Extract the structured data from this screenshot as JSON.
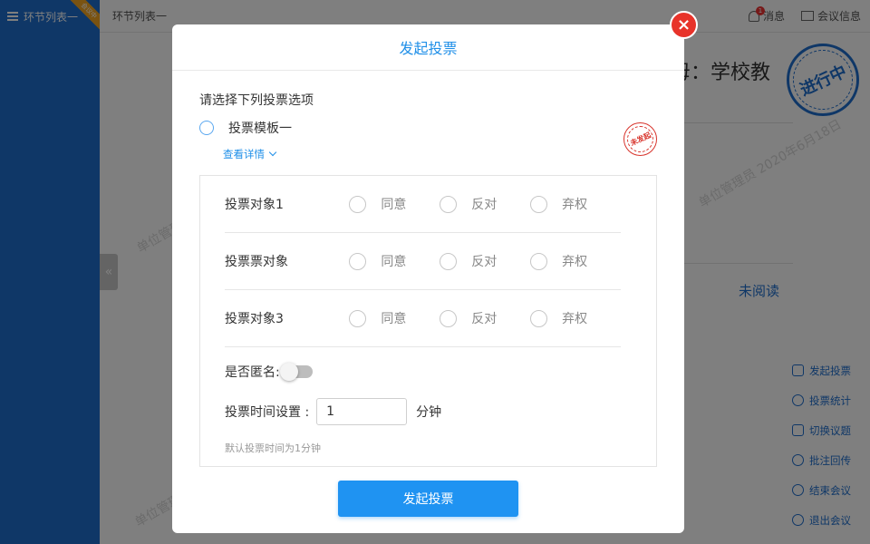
{
  "app": {
    "sidebar_title": "环节列表一",
    "ribbon": "会议中",
    "breadcrumb": "环节列表一",
    "messages_label": "消息",
    "message_count": "1",
    "meeting_info_label": "会议信息"
  },
  "background": {
    "title": "母：学校教",
    "unread": "未阅读",
    "status_stamp": "进行中",
    "collapse_icon": "«",
    "watermarks": [
      "单位管理员 2020年6月18日",
      "单位管理员 2020年6月",
      "单位管理员 2020年6月18日"
    ],
    "side_actions": [
      {
        "label": "发起投票",
        "icon": "vote-icon"
      },
      {
        "label": "投票统计",
        "icon": "pie-chart-icon"
      },
      {
        "label": "切换议题",
        "icon": "list-icon"
      },
      {
        "label": "批注回传",
        "icon": "annotate-icon"
      },
      {
        "label": "结束会议",
        "icon": "power-icon"
      },
      {
        "label": "退出会议",
        "icon": "exit-icon"
      }
    ]
  },
  "modal": {
    "title": "发起投票",
    "close_icon": "×",
    "prompt": "请选择下列投票选项",
    "template_label": "投票模板一",
    "details_link": "查看详情",
    "seal_text": "未发起",
    "items": [
      {
        "label": "投票对象1",
        "options": [
          "同意",
          "反对",
          "弃权"
        ]
      },
      {
        "label": "投票票对象",
        "options": [
          "同意",
          "反对",
          "弃权"
        ]
      },
      {
        "label": "投票对象3",
        "options": [
          "同意",
          "反对",
          "弃权"
        ]
      }
    ],
    "anonymous_label": "是否匿名:",
    "anonymous_on": false,
    "time_label": "投票时间设置 :",
    "time_value": "1",
    "time_unit": "分钟",
    "hint": "默认投票时间为1分钟",
    "submit_label": "发起投票"
  },
  "colors": {
    "accent": "#1f93f2",
    "sidebar": "#1f6fcf",
    "close": "#e8332a",
    "seal": "#d8332b"
  }
}
